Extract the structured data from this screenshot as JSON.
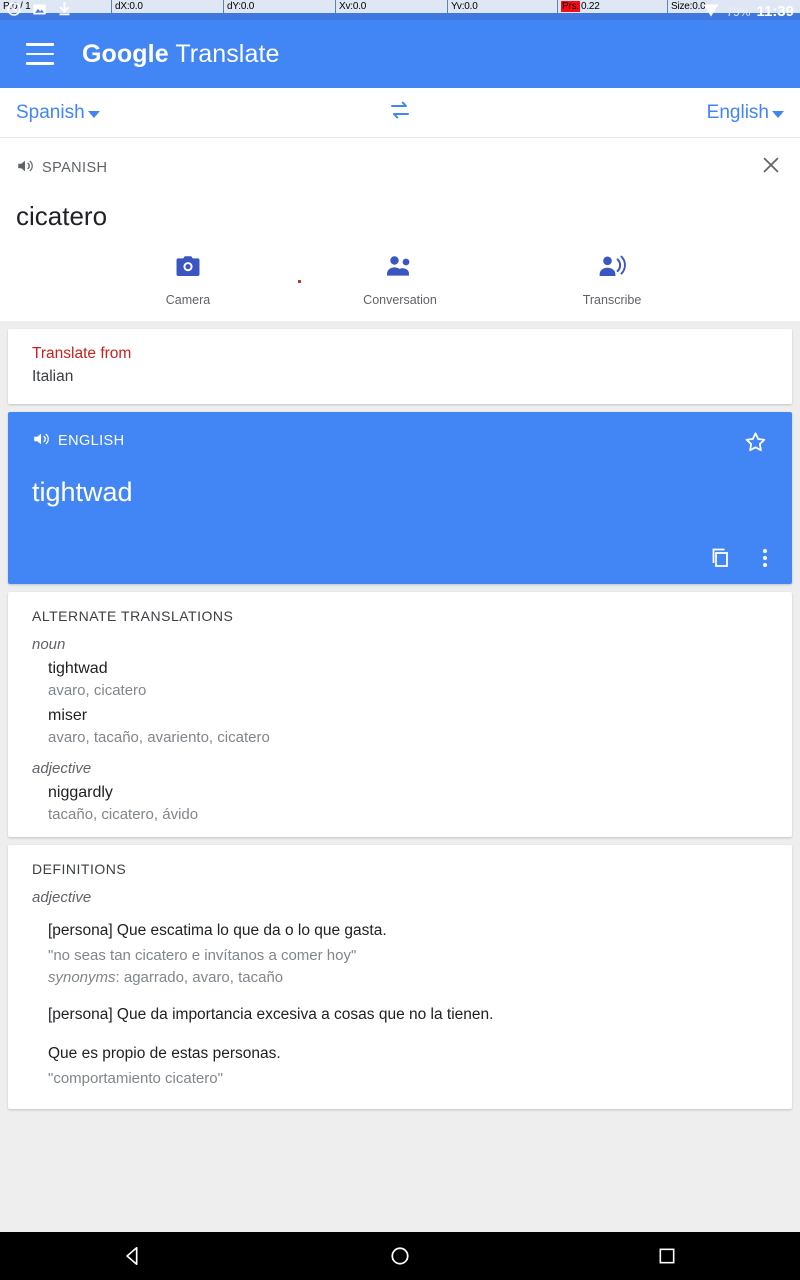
{
  "statusbar": {
    "debug_fields": [
      {
        "label": "P:",
        "value": "0 / 1",
        "highlight": false
      },
      {
        "label": "dX:",
        "value": "0.0",
        "highlight": false
      },
      {
        "label": "dY:",
        "value": "0.0",
        "highlight": false
      },
      {
        "label": "Xv:",
        "value": "0.0",
        "highlight": false
      },
      {
        "label": "Yv:",
        "value": "0.0",
        "highlight": false
      },
      {
        "label": "Prs:",
        "value": "0.22",
        "highlight": true
      },
      {
        "label": "Size:",
        "value": "0.0",
        "highlight": false
      }
    ],
    "battery": "79%",
    "clock": "11:39",
    "icons": [
      "clock-icon",
      "image-icon",
      "download-icon",
      "wifi-icon"
    ]
  },
  "appbar": {
    "menu_icon": "hamburger-menu-icon",
    "brand_bold": "Google",
    "brand_light": "Translate"
  },
  "langbar": {
    "source_language": "Spanish",
    "target_language": "English",
    "swap_icon": "swap-languages-icon"
  },
  "source": {
    "language_label": "SPANISH",
    "speaker_icon": "speaker-icon",
    "text": "cicatero",
    "close_icon": "close-icon"
  },
  "actions": [
    {
      "label": "Camera",
      "icon": "camera-icon"
    },
    {
      "label": "Conversation",
      "icon": "conversation-icon"
    },
    {
      "label": "Transcribe",
      "icon": "transcribe-icon"
    }
  ],
  "translate_from": {
    "title": "Translate from",
    "value": "Italian",
    "title_color": "#c5221f"
  },
  "translation": {
    "language_label": "ENGLISH",
    "speaker_icon": "speaker-icon",
    "text": "tightwad",
    "star_icon": "star-outline-icon",
    "copy_icon": "copy-icon",
    "more_icon": "more-vertical-icon",
    "card_color": "#4285f4"
  },
  "alternate_translations": {
    "title": "ALTERNATE TRANSLATIONS",
    "groups": [
      {
        "pos": "noun",
        "entries": [
          {
            "term": "tightwad",
            "back_translations": "avaro, cicatero"
          },
          {
            "term": "miser",
            "back_translations": "avaro, tacaño, avariento, cicatero"
          }
        ]
      },
      {
        "pos": "adjective",
        "entries": [
          {
            "term": "niggardly",
            "back_translations": "tacaño, cicatero, ávido"
          }
        ]
      }
    ]
  },
  "definitions": {
    "title": "DEFINITIONS",
    "groups": [
      {
        "pos": "adjective",
        "senses": [
          {
            "text": "[persona] Que escatima lo que da o lo que gasta.",
            "example": "\"no seas tan cicatero e invítanos a comer hoy\"",
            "synonyms_label": "synonyms",
            "synonyms": "agarrado, avaro, tacaño"
          },
          {
            "text": "[persona] Que da importancia excesiva a cosas que no la tienen.",
            "example": "",
            "synonyms_label": "",
            "synonyms": ""
          },
          {
            "text": "Que es propio de estas personas.",
            "example": "\"comportamiento cicatero\"",
            "synonyms_label": "",
            "synonyms": ""
          }
        ]
      }
    ]
  },
  "navbar": {
    "back_icon": "back-triangle-icon",
    "home_icon": "home-circle-icon",
    "recents_icon": "recents-square-icon"
  }
}
